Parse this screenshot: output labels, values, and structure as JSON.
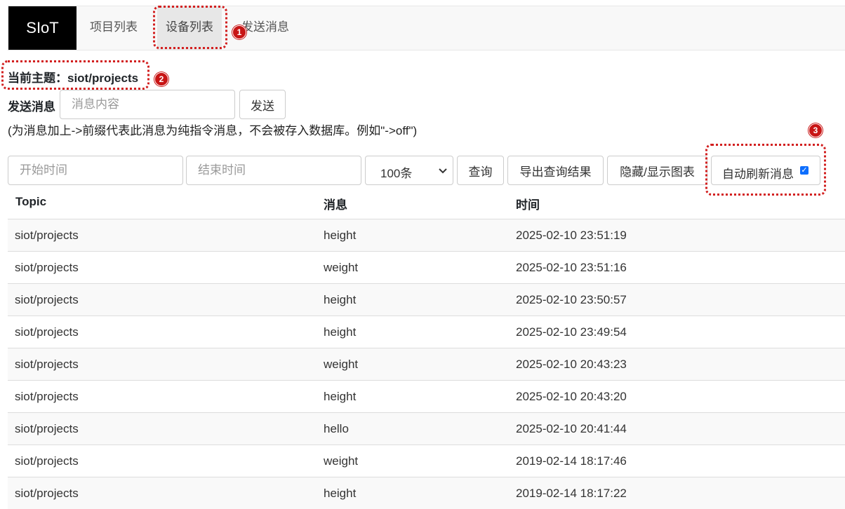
{
  "nav": {
    "brand": "SIoT",
    "items": [
      {
        "label": "项目列表"
      },
      {
        "label": "设备列表"
      },
      {
        "label": "发送消息"
      }
    ]
  },
  "annotations": [
    "1",
    "2",
    "3"
  ],
  "current_topic": "当前主题：siot/projects",
  "send": {
    "label": "发送消息",
    "placeholder": "消息内容",
    "button": "发送",
    "hint": "(为消息加上->前缀代表此消息为纯指令消息，不会被存入数据库。例如\"->off\")"
  },
  "filters": {
    "start_placeholder": "开始时间",
    "end_placeholder": "结束时间",
    "limit_selected": "100条",
    "query_button": "查询",
    "export_button": "导出查询结果",
    "toggle_chart_button": "隐藏/显示图表",
    "auto_refresh_label": "自动刷新消息",
    "auto_refresh_checked": true
  },
  "table": {
    "headers": [
      "Topic",
      "消息",
      "时间"
    ],
    "rows": [
      [
        "siot/projects",
        "height",
        "2025-02-10 23:51:19"
      ],
      [
        "siot/projects",
        "weight",
        "2025-02-10 23:51:16"
      ],
      [
        "siot/projects",
        "height",
        "2025-02-10 23:50:57"
      ],
      [
        "siot/projects",
        "height",
        "2025-02-10 23:49:54"
      ],
      [
        "siot/projects",
        "weight",
        "2025-02-10 20:43:23"
      ],
      [
        "siot/projects",
        "height",
        "2025-02-10 20:43:20"
      ],
      [
        "siot/projects",
        "hello",
        "2025-02-10 20:41:44"
      ],
      [
        "siot/projects",
        "weight",
        "2019-02-14 18:17:46"
      ],
      [
        "siot/projects",
        "height",
        "2019-02-14 18:17:22"
      ]
    ]
  }
}
